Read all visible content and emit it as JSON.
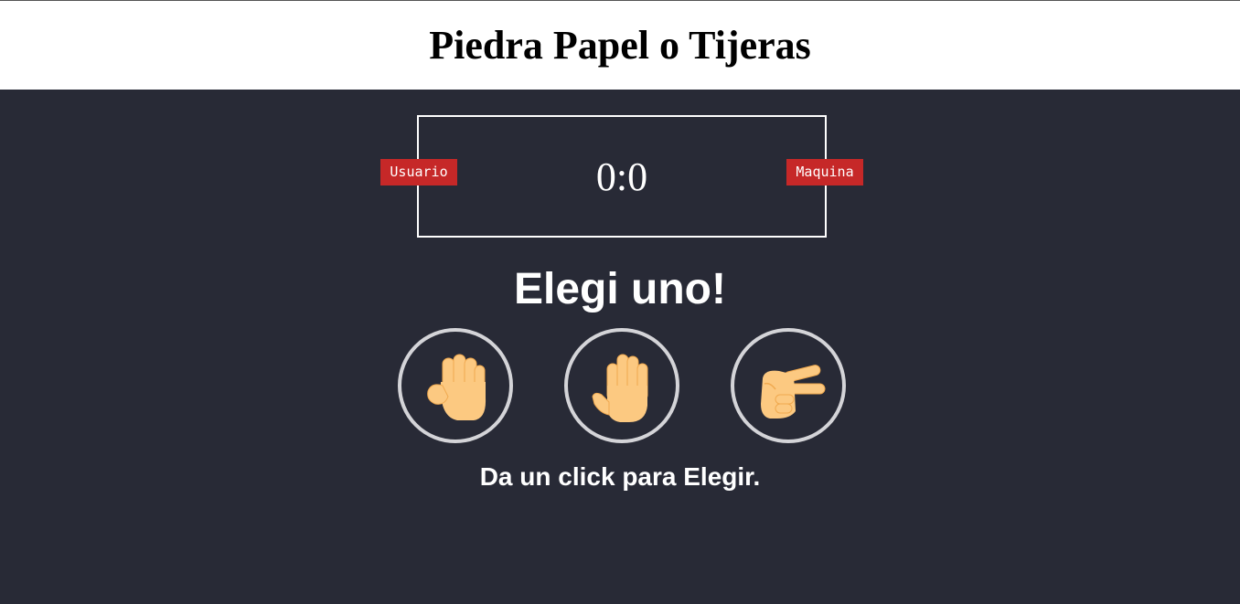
{
  "header": {
    "title": "Piedra Papel o Tijeras"
  },
  "scoreboard": {
    "score": "0:0",
    "user_label": "Usuario",
    "machine_label": "Maquina"
  },
  "main": {
    "title": "Elegi uno!",
    "hint": "Da un click para Elegir."
  },
  "choices": [
    {
      "name": "rock",
      "icon": "raised-fist-icon"
    },
    {
      "name": "paper",
      "icon": "raised-hand-icon"
    },
    {
      "name": "scissors",
      "icon": "victory-hand-icon"
    }
  ],
  "colors": {
    "background": "#282a36",
    "header_background": "#ffffff",
    "badge": "#c62828",
    "circle_border": "#d4d4d8",
    "skin": "#fcc981",
    "skin_shade": "#f0a94f"
  }
}
